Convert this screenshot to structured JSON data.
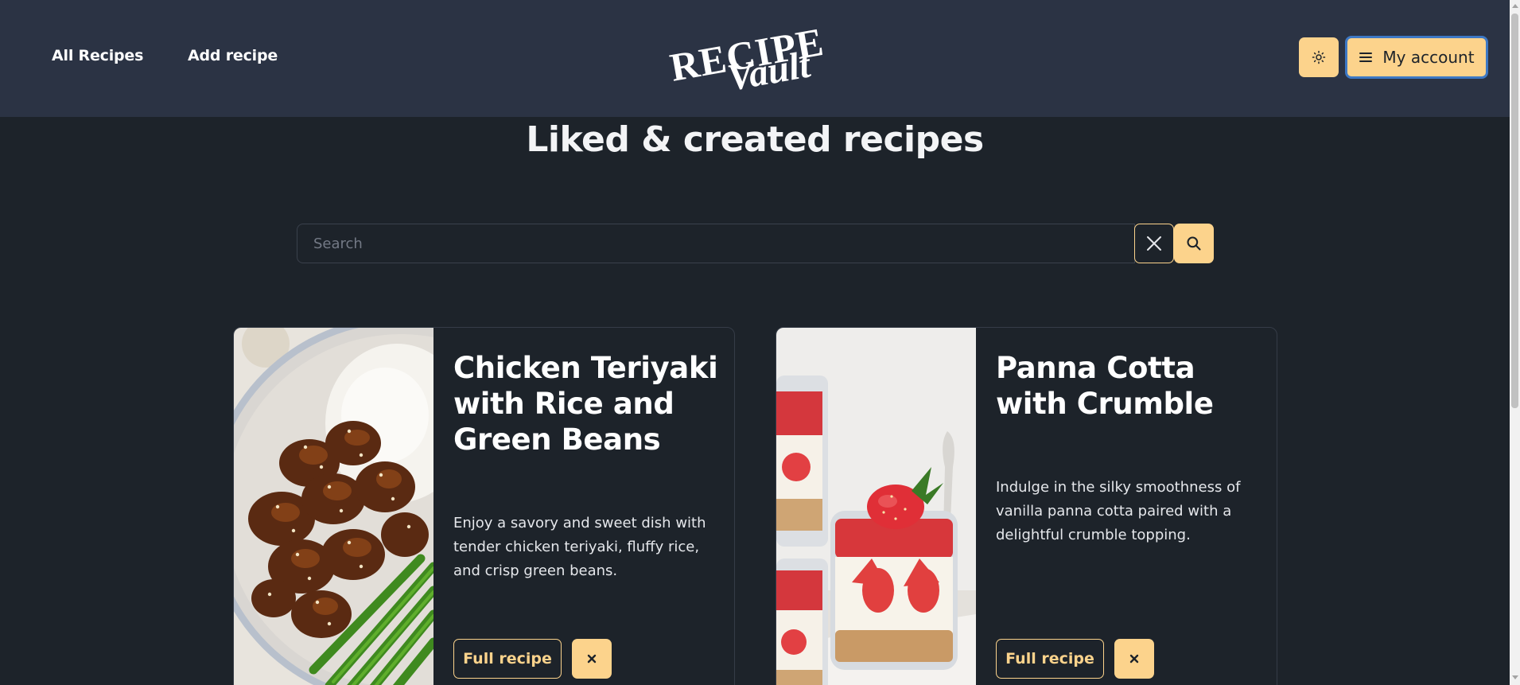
{
  "nav": {
    "links": [
      "All Recipes",
      "Add recipe"
    ],
    "logo_text": "RECIPE Vault",
    "theme_toggle_icon": "sun-icon",
    "account_label": "My account",
    "account_icon": "menu-icon"
  },
  "page": {
    "title": "Liked & created recipes"
  },
  "search": {
    "placeholder": "Search",
    "value": ""
  },
  "cards": [
    {
      "title": "Chicken Teriyaki with Rice and Green Beans",
      "description": "Enjoy a savory and sweet dish with tender chicken teriyaki, fluffy rice, and crisp green beans.",
      "full_recipe_label": "Full recipe",
      "remove_label": "×"
    },
    {
      "title": "Panna Cotta with Crumble",
      "description": "Indulge in the silky smoothness of vanilla panna cotta paired with a delightful crumble topping.",
      "full_recipe_label": "Full recipe",
      "remove_label": "×"
    }
  ],
  "colors": {
    "background": "#1d232a",
    "navbar": "#2b3344",
    "accent": "#fcd38c",
    "focus_ring": "#3d78c4"
  }
}
